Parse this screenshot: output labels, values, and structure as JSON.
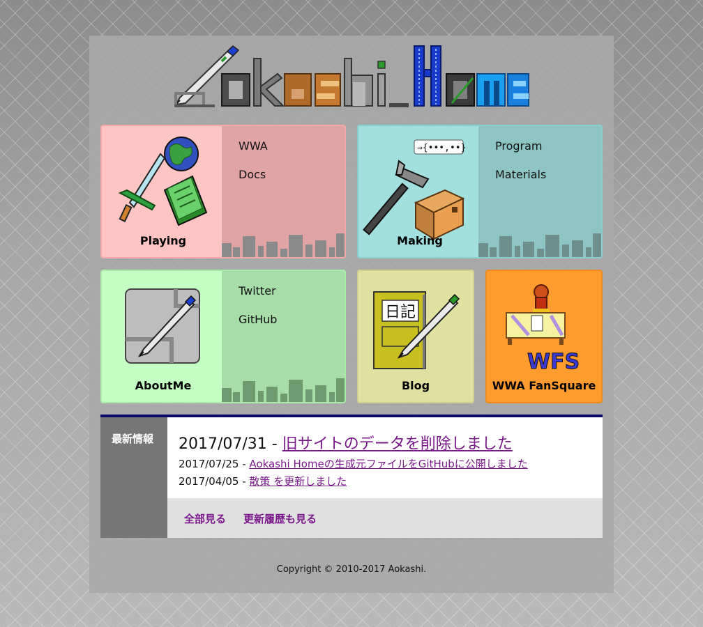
{
  "logo": {
    "text": "Aokashi_Home"
  },
  "cards": {
    "playing": {
      "title": "Playing",
      "links": [
        "WWA",
        "Docs"
      ]
    },
    "making": {
      "title": "Making",
      "links": [
        "Program",
        "Materials"
      ],
      "badge": "→{•••,••}"
    },
    "about": {
      "title": "AboutMe",
      "links": [
        "Twitter",
        "GitHub"
      ]
    },
    "blog": {
      "title": "Blog",
      "sign": "日記"
    },
    "wfs": {
      "title": "WWA FanSquare",
      "logo": "WFS"
    }
  },
  "news": {
    "heading": "最新情報",
    "items": [
      {
        "date": "2017/07/31",
        "sep": " - ",
        "text": "旧サイトのデータを削除しました"
      },
      {
        "date": "2017/07/25",
        "sep": " - ",
        "text": "Aokashi Homeの生成元ファイルをGitHubに公開しました"
      },
      {
        "date": "2017/04/05",
        "sep": " - ",
        "text": "散策 を更新しました"
      }
    ],
    "footer_links": [
      "全部見る",
      "更新履歴も見る"
    ]
  },
  "copyright": "Copyright © 2010-2017 Aokashi.",
  "colors": {
    "playing": "#ffc4c4",
    "making": "#a2e0e0",
    "about": "#c4ffc4",
    "blog": "#e0e0a0",
    "wfs": "#ff9c30",
    "news_border": "#0a0a6e",
    "link": "#7a1a8a"
  }
}
